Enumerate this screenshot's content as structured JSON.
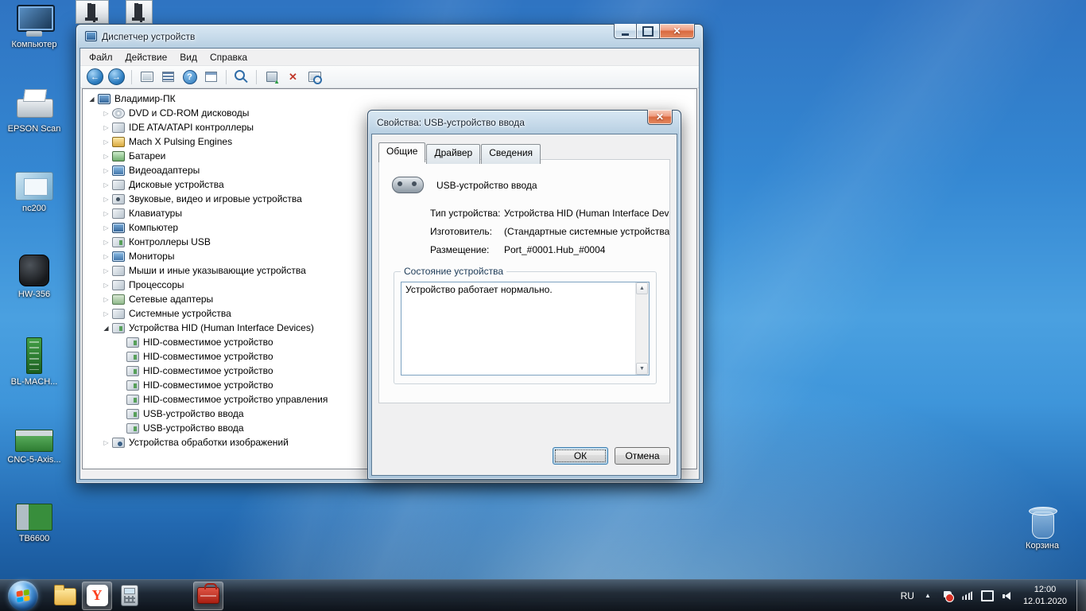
{
  "desktop": {
    "icons": [
      {
        "name": "computer",
        "label": "Компьютер"
      },
      {
        "name": "epson-scan",
        "label": "EPSON Scan"
      },
      {
        "name": "nc200",
        "label": "nc200"
      },
      {
        "name": "hw-356",
        "label": "HW-356"
      },
      {
        "name": "bl-mach",
        "label": "BL-MACH..."
      },
      {
        "name": "cnc-5-axis",
        "label": "CNC-5-Axis..."
      },
      {
        "name": "tb6600",
        "label": "TB6600"
      },
      {
        "name": "recycle-bin",
        "label": "Корзина"
      }
    ],
    "top_apps": [
      {
        "name": "mach3-app-1"
      },
      {
        "name": "mach3-app-2"
      }
    ]
  },
  "device_manager": {
    "title": "Диспетчер устройств",
    "menus": [
      "Файл",
      "Действие",
      "Вид",
      "Справка"
    ],
    "toolbar": [
      "back",
      "forward",
      "show-computer",
      "list-view",
      "help",
      "export",
      "scan-changes",
      "update-driver",
      "uninstall",
      "scan-hardware"
    ],
    "tree": [
      {
        "label": "Владимир-ПК",
        "icon": "computer",
        "expander": "expanded",
        "level": 0
      },
      {
        "label": "DVD и CD-ROM дисководы",
        "icon": "dvd",
        "expander": "collapsed",
        "level": 1
      },
      {
        "label": "IDE ATA/ATAPI контроллеры",
        "icon": "ide",
        "expander": "collapsed",
        "level": 1
      },
      {
        "label": "Mach X Pulsing Engines",
        "icon": "mach",
        "expander": "collapsed",
        "level": 1
      },
      {
        "label": "Батареи",
        "icon": "battery",
        "expander": "collapsed",
        "level": 1
      },
      {
        "label": "Видеоадаптеры",
        "icon": "video",
        "expander": "collapsed",
        "level": 1
      },
      {
        "label": "Дисковые устройства",
        "icon": "disk",
        "expander": "collapsed",
        "level": 1
      },
      {
        "label": "Звуковые, видео и игровые устройства",
        "icon": "sound",
        "expander": "collapsed",
        "level": 1
      },
      {
        "label": "Клавиатуры",
        "icon": "keyboard",
        "expander": "collapsed",
        "level": 1
      },
      {
        "label": "Компьютер",
        "icon": "computer",
        "expander": "collapsed",
        "level": 1
      },
      {
        "label": "Контроллеры USB",
        "icon": "usb",
        "expander": "collapsed",
        "level": 1
      },
      {
        "label": "Мониторы",
        "icon": "monitor",
        "expander": "collapsed",
        "level": 1
      },
      {
        "label": "Мыши и иные указывающие устройства",
        "icon": "mouse",
        "expander": "collapsed",
        "level": 1
      },
      {
        "label": "Процессоры",
        "icon": "cpu",
        "expander": "collapsed",
        "level": 1
      },
      {
        "label": "Сетевые адаптеры",
        "icon": "network",
        "expander": "collapsed",
        "level": 1
      },
      {
        "label": "Системные устройства",
        "icon": "system",
        "expander": "collapsed",
        "level": 1
      },
      {
        "label": "Устройства HID (Human Interface Devices)",
        "icon": "hid",
        "expander": "expanded",
        "level": 1
      },
      {
        "label": "HID-совместимое устройство",
        "icon": "hid",
        "expander": "none",
        "level": 2
      },
      {
        "label": "HID-совместимое устройство",
        "icon": "hid",
        "expander": "none",
        "level": 2
      },
      {
        "label": "HID-совместимое устройство",
        "icon": "hid",
        "expander": "none",
        "level": 2
      },
      {
        "label": "HID-совместимое устройство",
        "icon": "hid",
        "expander": "none",
        "level": 2
      },
      {
        "label": "HID-совместимое устройство управления",
        "icon": "hid",
        "expander": "none",
        "level": 2
      },
      {
        "label": "USB-устройство ввода",
        "icon": "hid",
        "expander": "none",
        "level": 2
      },
      {
        "label": "USB-устройство ввода",
        "icon": "hid",
        "expander": "none",
        "level": 2
      },
      {
        "label": "Устройства обработки изображений",
        "icon": "camera",
        "expander": "collapsed",
        "level": 1
      }
    ]
  },
  "dialog": {
    "title": "Свойства: USB-устройство ввода",
    "tabs": [
      {
        "label": "Общие",
        "active": true
      },
      {
        "label": "Драйвер",
        "active": false
      },
      {
        "label": "Сведения",
        "active": false
      }
    ],
    "device_name": "USB-устройство ввода",
    "fields": [
      {
        "label": "Тип устройства:",
        "value": "Устройства HID (Human Interface Devices)"
      },
      {
        "label": "Изготовитель:",
        "value": "(Стандартные системные устройства)"
      },
      {
        "label": "Размещение:",
        "value": "Port_#0001.Hub_#0004"
      }
    ],
    "status_group": "Состояние устройства",
    "status_text": "Устройство работает нормально.",
    "buttons": {
      "ok": "ОК",
      "cancel": "Отмена"
    }
  },
  "taskbar": {
    "apps": [
      {
        "name": "explorer",
        "active": false
      },
      {
        "name": "yandex-browser",
        "active": true,
        "glyph": "Y"
      },
      {
        "name": "calculator",
        "active": false
      },
      {
        "name": "mach3-loader",
        "active": true
      }
    ],
    "tray": {
      "language": "RU",
      "icons": [
        "hidden-icons-arrow",
        "action-center-flag",
        "network-signal",
        "network-status",
        "volume"
      ],
      "time": "12:00",
      "date": "12.01.2020"
    }
  }
}
